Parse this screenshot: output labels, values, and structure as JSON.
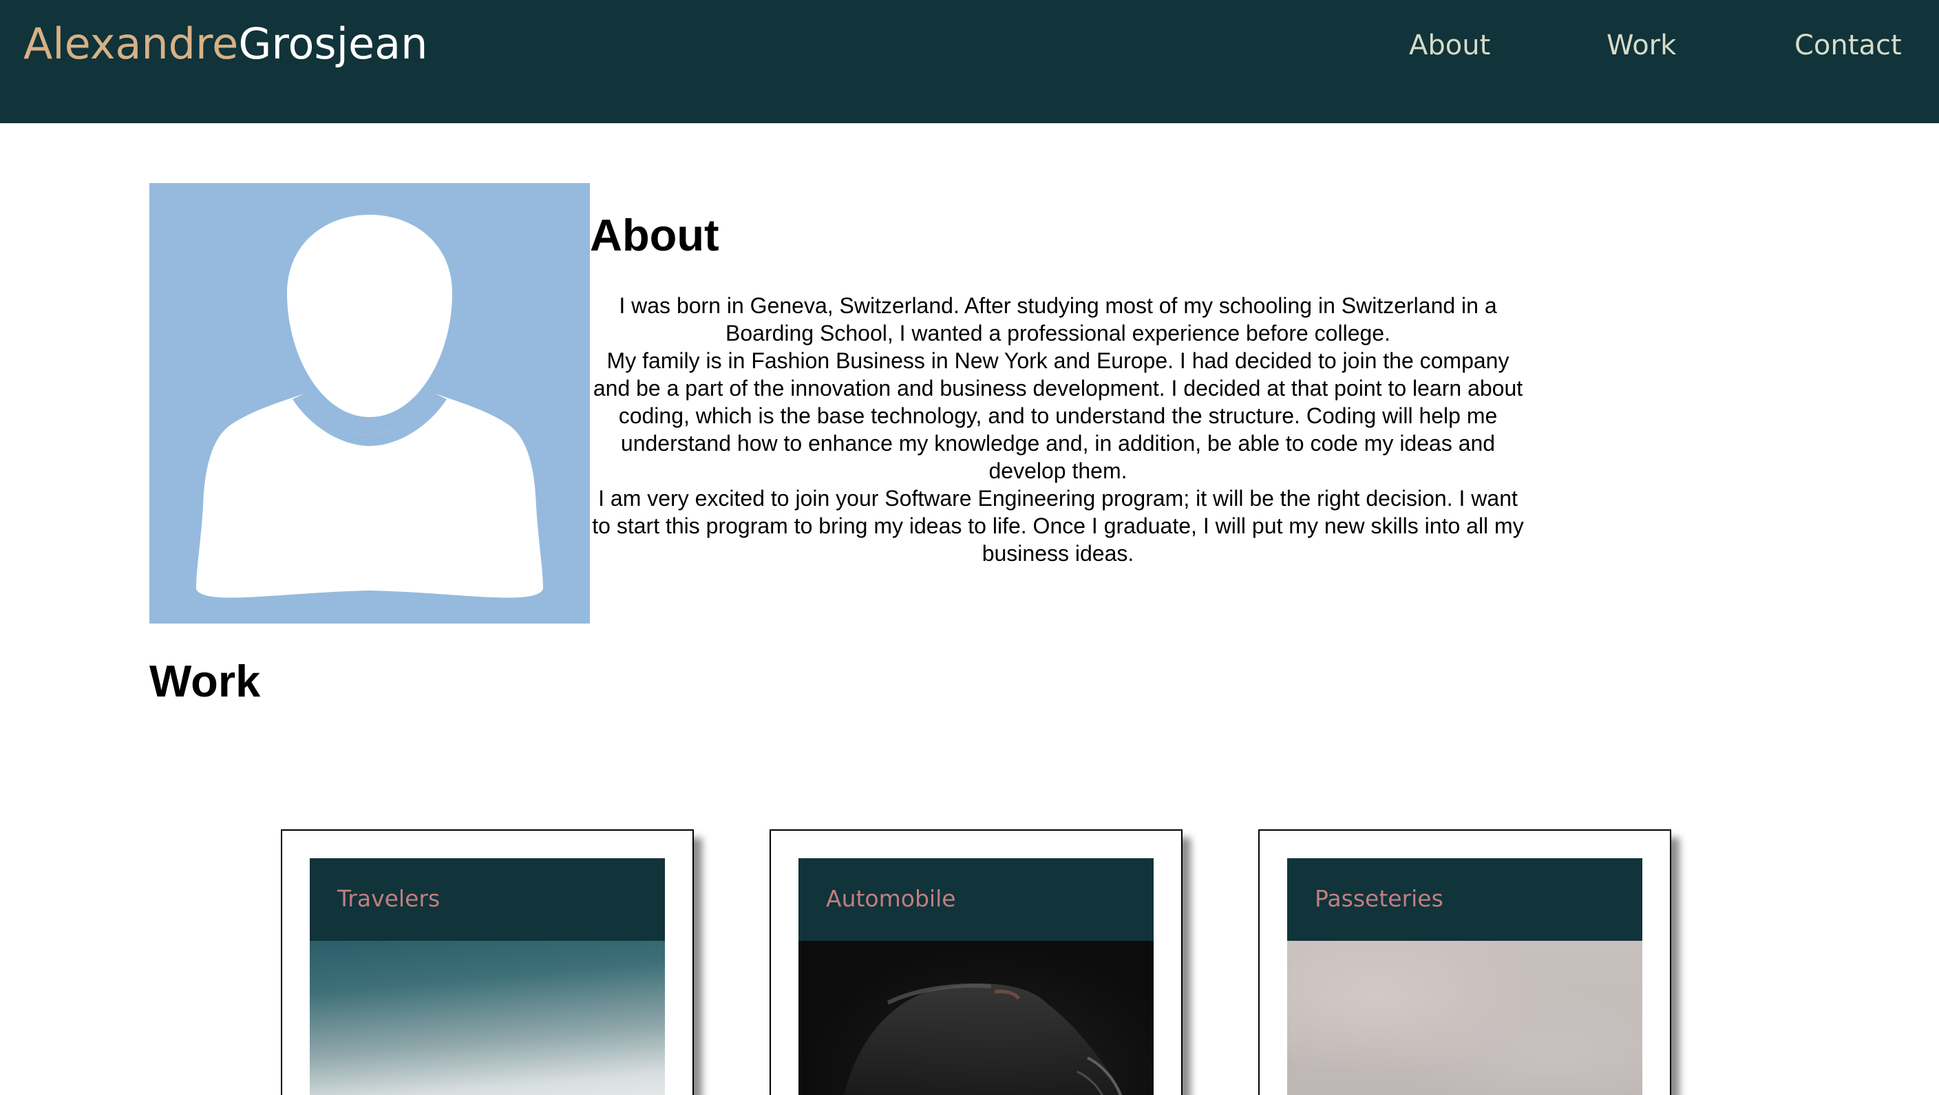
{
  "header": {
    "brand_first": "Alexandre",
    "brand_last": "Grosjean",
    "nav": {
      "about": "About",
      "work": "Work",
      "contact": "Contact"
    }
  },
  "about": {
    "heading": "About",
    "paragraphs": [
      "I was born in Geneva, Switzerland. After studying most of my schooling in Switzerland in a Boarding School, I wanted a professional experience before college.",
      "My family is in Fashion Business in New York and Europe. I had decided to join the company and be a part of the innovation and business development. I decided at that point to learn about coding, which is the base technology, and to understand the structure. Coding will help me understand how to enhance my knowledge and, in addition, be able to code my ideas and develop them.",
      "I am very excited to join your Software Engineering program; it will be the right decision. I want to start this program to bring my ideas to life. Once I graduate, I will put my new skills into all my business ideas."
    ]
  },
  "work": {
    "heading": "Work",
    "projects": [
      {
        "title": "Travelers"
      },
      {
        "title": "Automobile"
      },
      {
        "title": "Passeteries"
      }
    ]
  },
  "colors": {
    "header_bg": "#11333a",
    "brand_first": "#d7b186",
    "brand_last": "#ffffff",
    "nav_link": "#d6dcc7",
    "avatar_bg": "#95bade",
    "card_title": "#c07f7f"
  }
}
